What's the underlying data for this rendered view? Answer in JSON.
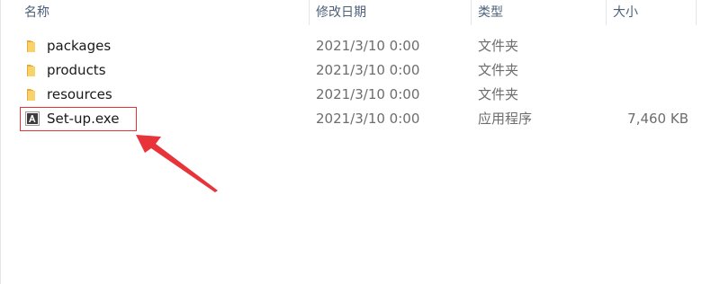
{
  "columns": {
    "name": "名称",
    "modified": "修改日期",
    "type": "类型",
    "size": "大小"
  },
  "files": [
    {
      "name": "packages",
      "modified": "2021/3/10 0:00",
      "type": "文件夹",
      "size": "",
      "icon": "folder-icon"
    },
    {
      "name": "products",
      "modified": "2021/3/10 0:00",
      "type": "文件夹",
      "size": "",
      "icon": "folder-icon"
    },
    {
      "name": "resources",
      "modified": "2021/3/10 0:00",
      "type": "文件夹",
      "size": "",
      "icon": "folder-icon"
    },
    {
      "name": "Set-up.exe",
      "modified": "2021/3/10 0:00",
      "type": "应用程序",
      "size": "7,460 KB",
      "icon": "adobe-installer-icon"
    }
  ],
  "colors": {
    "header_text": "#4c607a",
    "secondary_text": "#6d6d6d",
    "folder": "#f2c04a",
    "annotation": "#e8333a"
  },
  "annotation": {
    "highlighted_item": "Set-up.exe",
    "arrow_icon": "red-arrow-icon"
  }
}
